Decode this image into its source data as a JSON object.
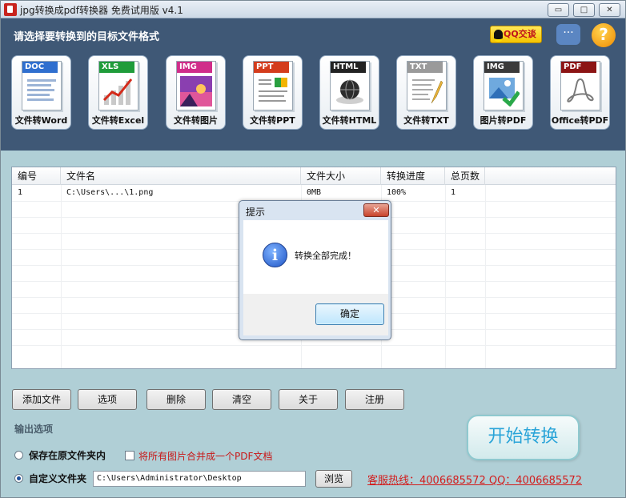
{
  "window": {
    "title": "jpg转换成pdf转换器 免费试用版 v4.1",
    "min_glyph": "▭",
    "max_glyph": "□",
    "close_glyph": "✕"
  },
  "header": {
    "title": "请选择要转换到的目标文件格式",
    "qq_label": "QQ交谈",
    "chat_glyph": "···",
    "help_glyph": "?"
  },
  "tools": [
    {
      "tag": "DOC",
      "tag_color": "#2f6fcf",
      "label": "文件转Word"
    },
    {
      "tag": "XLS",
      "tag_color": "#1f9c3a",
      "label": "文件转Excel"
    },
    {
      "tag": "IMG",
      "tag_color": "#d02d8a",
      "label": "文件转图片"
    },
    {
      "tag": "PPT",
      "tag_color": "#d43c1c",
      "label": "文件转PPT"
    },
    {
      "tag": "HTML",
      "tag_color": "#222222",
      "label": "文件转HTML"
    },
    {
      "tag": "TXT",
      "tag_color": "#9a9a9a",
      "label": "文件转TXT"
    },
    {
      "tag": "IMG",
      "tag_color": "#3a3a3a",
      "label": "图片转PDF"
    },
    {
      "tag": "PDF",
      "tag_color": "#8c1414",
      "label": "Office转PDF"
    }
  ],
  "list": {
    "columns": [
      "编号",
      "文件名",
      "文件大小",
      "转换进度",
      "总页数"
    ],
    "rows": [
      {
        "id": "1",
        "name": "C:\\Users\\...\\1.png",
        "size": "0MB",
        "progress": "100%",
        "pages": "1"
      }
    ]
  },
  "dialog": {
    "title": "提示",
    "close_glyph": "✕",
    "info_glyph": "i",
    "message": "转换全部完成！",
    "ok_label": "确定"
  },
  "buttons": {
    "add": "添加文件",
    "options": "选项",
    "delete": "删除",
    "clear": "清空",
    "about": "关于",
    "register": "注册"
  },
  "output": {
    "section_label": "输出选项",
    "save_original": "保存在原文件夹内",
    "merge_label": "将所有图片合并成一个PDF文档",
    "custom_folder": "自定义文件夹",
    "path": "C:\\Users\\Administrator\\Desktop",
    "browse": "浏览",
    "hotline": "客服热线：4006685572 QQ：4006685572",
    "start": "开始转换"
  }
}
